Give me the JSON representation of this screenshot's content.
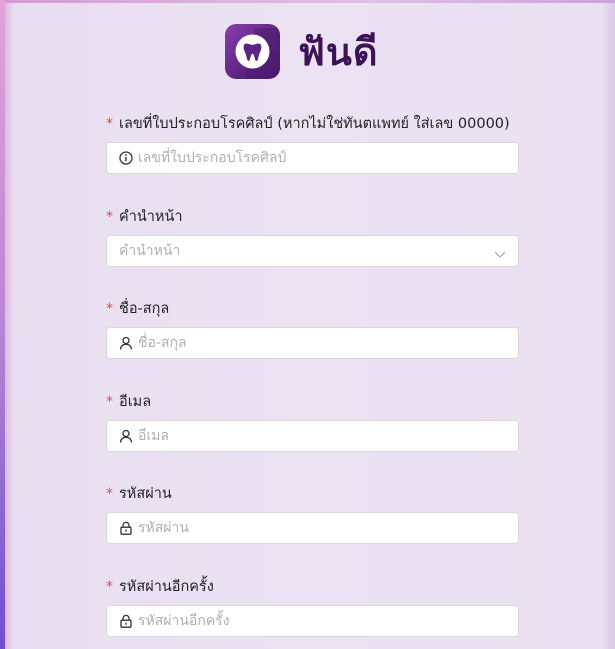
{
  "brand": {
    "name": "ฟันดี",
    "tile_color": "#5c2483",
    "text_color": "#3d1256"
  },
  "accent": {
    "required": "#e5484d"
  },
  "form": {
    "license": {
      "label": "เลขที่ใบประกอบโรคศิลป์ (หากไม่ใช่ทันตแพทย์ ใส่เลข 00000)",
      "placeholder": "เลขที่ใบประกอบโรคศิลป์",
      "icon": "info-icon",
      "required": "*"
    },
    "prefix": {
      "label": "คำนำหน้า",
      "placeholder": "คำนำหน้า",
      "icon": "chevron-down-icon",
      "required": "*"
    },
    "fullname": {
      "label": "ชื่อ-สกุล",
      "placeholder": "ชื่อ-สกุล",
      "icon": "user-icon",
      "required": "*"
    },
    "email": {
      "label": "อีเมล",
      "placeholder": "อีเมล",
      "icon": "user-icon",
      "required": "*"
    },
    "password": {
      "label": "รหัสผ่าน",
      "placeholder": "รหัสผ่าน",
      "icon": "lock-icon",
      "required": "*"
    },
    "confirm_password": {
      "label": "รหัสผ่านอีกครั้ง",
      "placeholder": "รหัสผ่านอีกครั้ง",
      "icon": "lock-icon",
      "required": "*"
    }
  }
}
